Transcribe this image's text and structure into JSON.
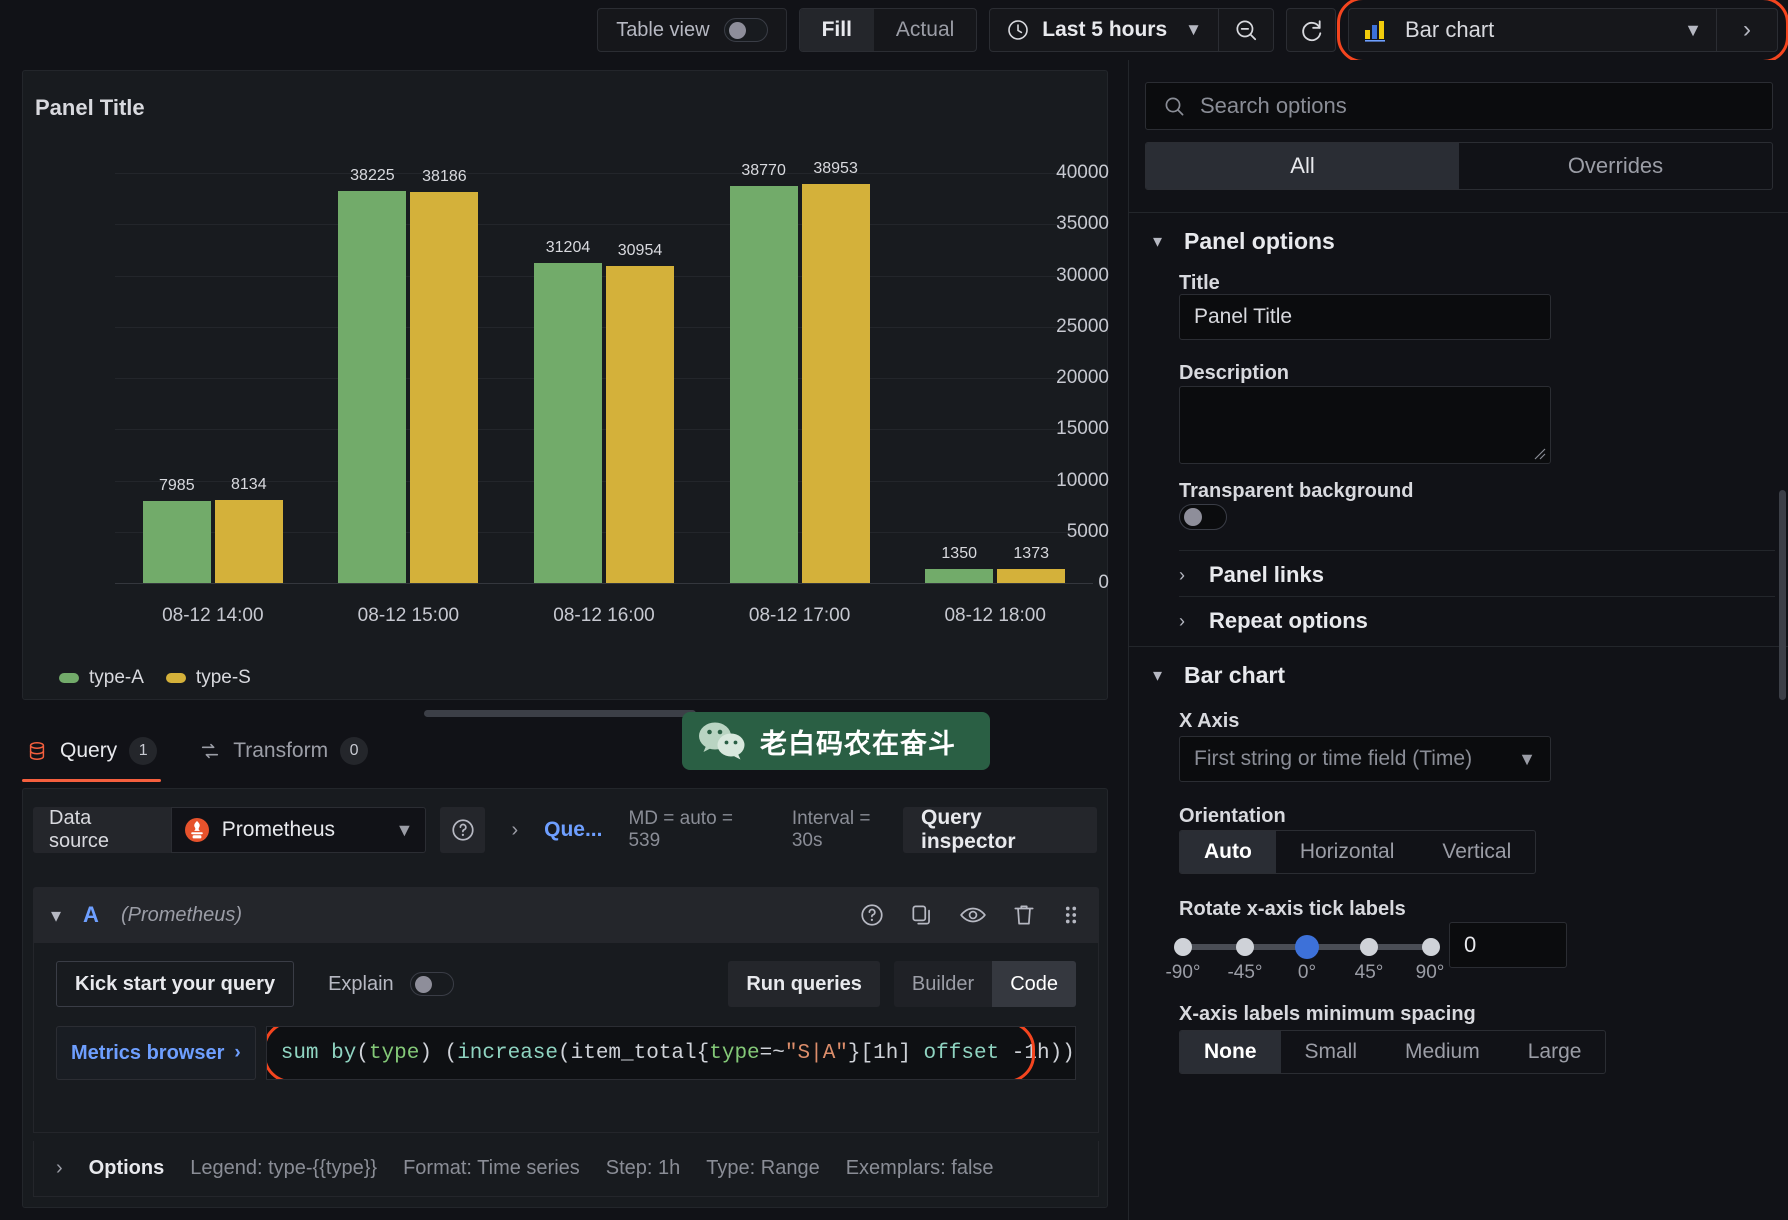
{
  "toolbar": {
    "table_view_label": "Table view",
    "fill_label": "Fill",
    "actual_label": "Actual",
    "time_range": "Last 5 hours",
    "clock_icon": "clock-icon",
    "zoom_out_icon": "zoom-out-icon",
    "refresh_icon": "refresh-icon",
    "viz_name": "Bar chart",
    "viz_icon": "bar-chart-icon",
    "chevron_down": "chevron-down-icon",
    "chevron_right": "chevron-right-icon"
  },
  "panel": {
    "title": "Panel Title"
  },
  "chart_data": {
    "type": "bar",
    "title": "Panel Title",
    "xlabel": "",
    "ylabel": "",
    "ylim": [
      0,
      40000
    ],
    "grid": true,
    "legend_position": "bottom-left",
    "yticks": [
      0,
      5000,
      10000,
      15000,
      20000,
      25000,
      30000,
      35000,
      40000
    ],
    "categories": [
      "08-12 14:00",
      "08-12 15:00",
      "08-12 16:00",
      "08-12 17:00",
      "08-12 18:00"
    ],
    "series": [
      {
        "name": "type-A",
        "color": "#72ab6a",
        "values": [
          7985,
          38225,
          31204,
          38770,
          1350
        ]
      },
      {
        "name": "type-S",
        "color": "#d4b13a",
        "values": [
          8134,
          38186,
          30954,
          38953,
          1373
        ]
      }
    ]
  },
  "watermark": {
    "text": "老白码农在奋斗",
    "icon": "wechat-icon"
  },
  "tabs": [
    {
      "label": "Query",
      "badge": "1",
      "icon": "database-icon",
      "active": true
    },
    {
      "label": "Transform",
      "badge": "0",
      "icon": "transform-icon",
      "active": false
    }
  ],
  "query_section": {
    "data_source_label": "Data source",
    "data_source_value": "Prometheus",
    "data_source_icon": "prometheus-icon",
    "help_icon": "question-circle-icon",
    "query_options_link": "Que...",
    "max_data_points": "MD = auto = 539",
    "interval": "Interval = 30s",
    "query_inspector_label": "Query inspector",
    "row": {
      "ref_id": "A",
      "ds_name": "(Prometheus)",
      "icons": [
        "question-circle-icon",
        "copy-icon",
        "eye-icon",
        "trash-icon",
        "drag-handle-icon"
      ]
    },
    "kick_start_label": "Kick start your query",
    "explain_label": "Explain",
    "run_queries_label": "Run queries",
    "builder_label": "Builder",
    "code_label": "Code",
    "metrics_browser_label": "Metrics browser",
    "expression": "sum by(type) (increase(item_total{type=~\"S|A\"}[1h] offset -1h))",
    "expression_tokens": [
      {
        "t": "sum by",
        "c": "fn"
      },
      {
        "t": "(",
        "c": "plain"
      },
      {
        "t": "type",
        "c": "lbl"
      },
      {
        "t": ") (",
        "c": "plain"
      },
      {
        "t": "increase",
        "c": "fn"
      },
      {
        "t": "(item_total{",
        "c": "plain"
      },
      {
        "t": "type",
        "c": "lbl"
      },
      {
        "t": "=~",
        "c": "plain"
      },
      {
        "t": "\"S|A\"",
        "c": "str"
      },
      {
        "t": "}[1h] ",
        "c": "plain"
      },
      {
        "t": "offset",
        "c": "fn"
      },
      {
        "t": " -1h))",
        "c": "plain"
      }
    ],
    "options": {
      "label": "Options",
      "items": [
        "Legend: type-{{type}}",
        "Format: Time series",
        "Step: 1h",
        "Type: Range",
        "Exemplars: false"
      ]
    }
  },
  "sidebar": {
    "search_placeholder": "Search options",
    "search_icon": "search-icon",
    "tabs": [
      {
        "label": "All",
        "active": true
      },
      {
        "label": "Overrides",
        "active": false
      }
    ],
    "panel_options": {
      "header": "Panel options",
      "title_label": "Title",
      "title_value": "Panel Title",
      "description_label": "Description",
      "description_value": "",
      "transparent_label": "Transparent background",
      "transparent_on": false,
      "panel_links_label": "Panel links",
      "repeat_options_label": "Repeat options"
    },
    "bar_chart": {
      "header": "Bar chart",
      "x_axis_label": "X Axis",
      "x_axis_value": "First string or time field (Time)",
      "orientation_label": "Orientation",
      "orientation_options": [
        "Auto",
        "Horizontal",
        "Vertical"
      ],
      "orientation_selected": "Auto",
      "rotate_label": "Rotate x-axis tick labels",
      "rotate_ticks": [
        "-90°",
        "-45°",
        "0°",
        "45°",
        "90°"
      ],
      "rotate_value": "0",
      "spacing_label": "X-axis labels minimum spacing",
      "spacing_options": [
        "None",
        "Small",
        "Medium",
        "Large"
      ],
      "spacing_selected": "None"
    }
  },
  "colors": {
    "accent": "#f55f3e",
    "highlight_ring": "#f4451f",
    "link": "#6e9fff",
    "series_a": "#72ab6a",
    "series_s": "#d4b13a"
  }
}
